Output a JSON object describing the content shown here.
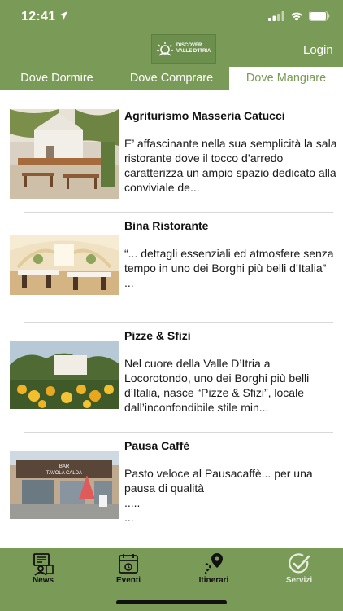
{
  "status_bar": {
    "time": "12:41"
  },
  "header": {
    "logo_line1": "DISCOVER",
    "logo_line2": "VALLE D'ITRIA",
    "login_label": "Login"
  },
  "tabs": [
    {
      "label": "Dove Dormire"
    },
    {
      "label": "Dove Comprare"
    },
    {
      "label": "Dove Mangiare",
      "active": true
    }
  ],
  "items": [
    {
      "title": "Agriturismo Masseria Catucci",
      "description": "E’ affascinante nella sua semplicità la sala ristorante dove il tocco d’arredo caratterizza un ampio spazio dedicato alla conviviale de..."
    },
    {
      "title": "Bina Ristorante",
      "description": "“... dettagli essenziali ed atmosfere senza tempo in uno dei Borghi più belli d’Italia”\n..."
    },
    {
      "title": "Pizze & Sfizi",
      "description": "Nel cuore della Valle D’Itria a Locorotondo, uno dei Borghi più belli d’Italia, nasce “Pizze & Sfizi”, locale dall’inconfondibile stile min..."
    },
    {
      "title": "Pausa Caffè",
      "description": "Pasto veloce al Pausacaffè... per una pausa di qualità\n.....\n...",
      "sign_text_1": "BAR",
      "sign_text_2": "TAVOLA CALDA"
    }
  ],
  "bottom_nav": [
    {
      "label": "News",
      "icon": "news-icon"
    },
    {
      "label": "Eventi",
      "icon": "calendar-icon"
    },
    {
      "label": "Itinerari",
      "icon": "route-pin-icon"
    },
    {
      "label": "Servizi",
      "icon": "check-circle-icon",
      "active": true
    }
  ],
  "colors": {
    "brand_green": "#7a9a58",
    "active_tab_bg": "#ffffff",
    "text": "#111111"
  }
}
